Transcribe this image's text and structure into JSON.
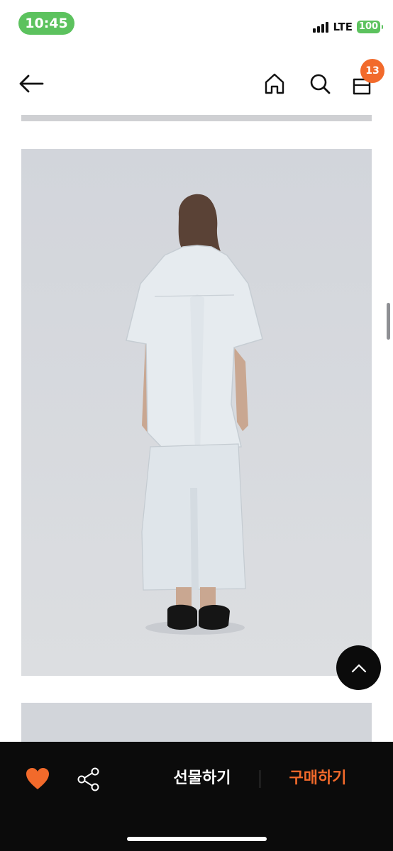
{
  "status_bar": {
    "time": "10:45",
    "network": "LTE",
    "battery": "100",
    "time_pill_color": "#5cc25e"
  },
  "nav": {
    "back_icon": "arrow-left-icon",
    "home_icon": "home-icon",
    "search_icon": "search-icon",
    "cart_icon": "shopping-bag-icon",
    "cart_count": "13",
    "badge_color": "#f26a2b"
  },
  "content": {
    "photo_background": "#d6d9de"
  },
  "bottom_bar": {
    "gift_label": "선물하기",
    "buy_label": "구매하기",
    "accent_color": "#f26a2b",
    "heart_icon": "heart-icon",
    "share_icon": "share-icon"
  }
}
